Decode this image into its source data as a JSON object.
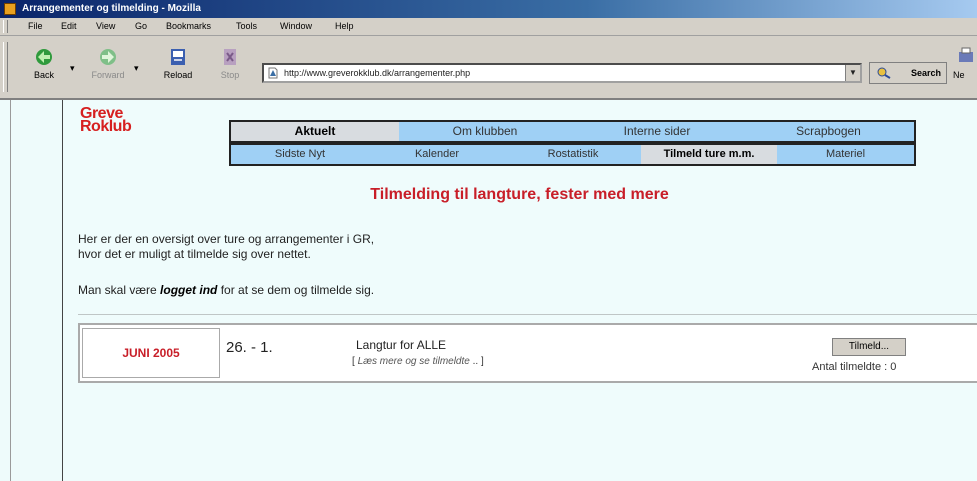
{
  "window": {
    "title": "Arrangementer og tilmelding - Mozilla"
  },
  "menu": [
    "File",
    "Edit",
    "View",
    "Go",
    "Bookmarks",
    "Tools",
    "Window",
    "Help"
  ],
  "toolbar": {
    "back": "Back",
    "forward": "Forward",
    "reload": "Reload",
    "stop": "Stop",
    "url": "http://www.greverokklub.dk/arrangementer.php",
    "search": "Search",
    "next_partial": "Ne"
  },
  "site": {
    "logo_line1": "Greve",
    "logo_line2": "Roklub",
    "nav_main": [
      "Aktuelt",
      "Om klubben",
      "Interne sider",
      "Scrapbogen"
    ],
    "nav_sub": [
      "Sidste Nyt",
      "Kalender",
      "Rostatistik",
      "Tilmeld ture m.m.",
      "Materiel"
    ]
  },
  "page": {
    "heading": "Tilmelding til langture, fester med mere",
    "intro_line1": "Her er der en oversigt over ture og arrangementer i GR,",
    "intro_line2": "hvor det er muligt at tilmelde sig over nettet.",
    "login_pre": "Man skal være ",
    "login_bold": "logget ind",
    "login_post": " for at se dem og tilmelde sig."
  },
  "event": {
    "month": "JUNI 2005",
    "dates": "26. - 1.",
    "title": "Langtur for ALLE",
    "more_open": "[ ",
    "more_link": "Læs mere og se tilmeldte",
    "more_close": " .. ]",
    "button": "Tilmeld...",
    "count_label": "Antal tilmeldte : 0"
  },
  "colors": {
    "accent_red": "#c81e28",
    "tab_blue": "#9fd0f5",
    "page_bg": "#eefbfb"
  }
}
